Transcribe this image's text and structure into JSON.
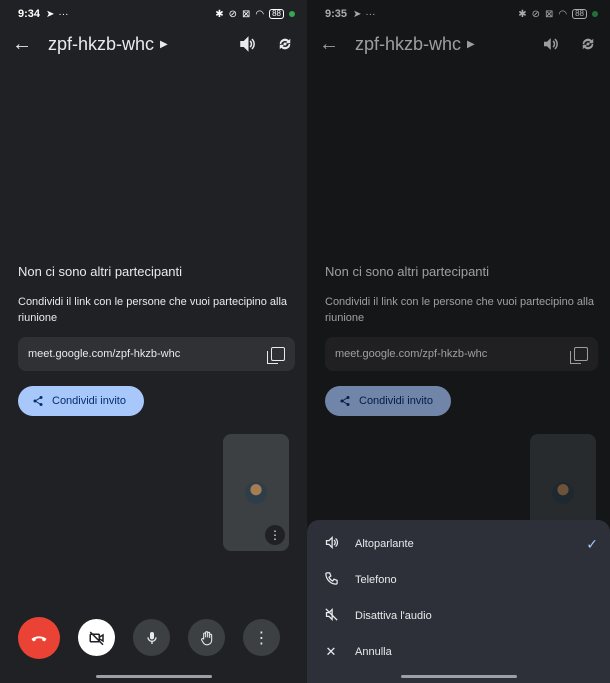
{
  "left": {
    "status": {
      "time": "9:34",
      "battery": "88"
    },
    "title": "zpf-hkzb-whc",
    "heading": "Non ci sono altri partecipanti",
    "description": "Condividi il link con le persone che vuoi partecipino alla riunione",
    "link": "meet.google.com/zpf-hkzb-whc",
    "share_label": "Condividi invito"
  },
  "right": {
    "status": {
      "time": "9:35",
      "battery": "88"
    },
    "title": "zpf-hkzb-whc",
    "heading": "Non ci sono altri partecipanti",
    "description": "Condividi il link con le persone che vuoi partecipino alla riunione",
    "link": "meet.google.com/zpf-hkzb-whc",
    "share_label": "Condividi invito",
    "menu": [
      {
        "label": "Altoparlante",
        "icon": "speaker-icon",
        "selected": true
      },
      {
        "label": "Telefono",
        "icon": "phone-icon"
      },
      {
        "label": "Disattiva l'audio",
        "icon": "mute-audio-icon"
      },
      {
        "label": "Annulla",
        "icon": "close-icon"
      }
    ]
  },
  "colors": {
    "accent": "#a8c7fa",
    "end_call": "#ea4335",
    "background": "#202124"
  }
}
